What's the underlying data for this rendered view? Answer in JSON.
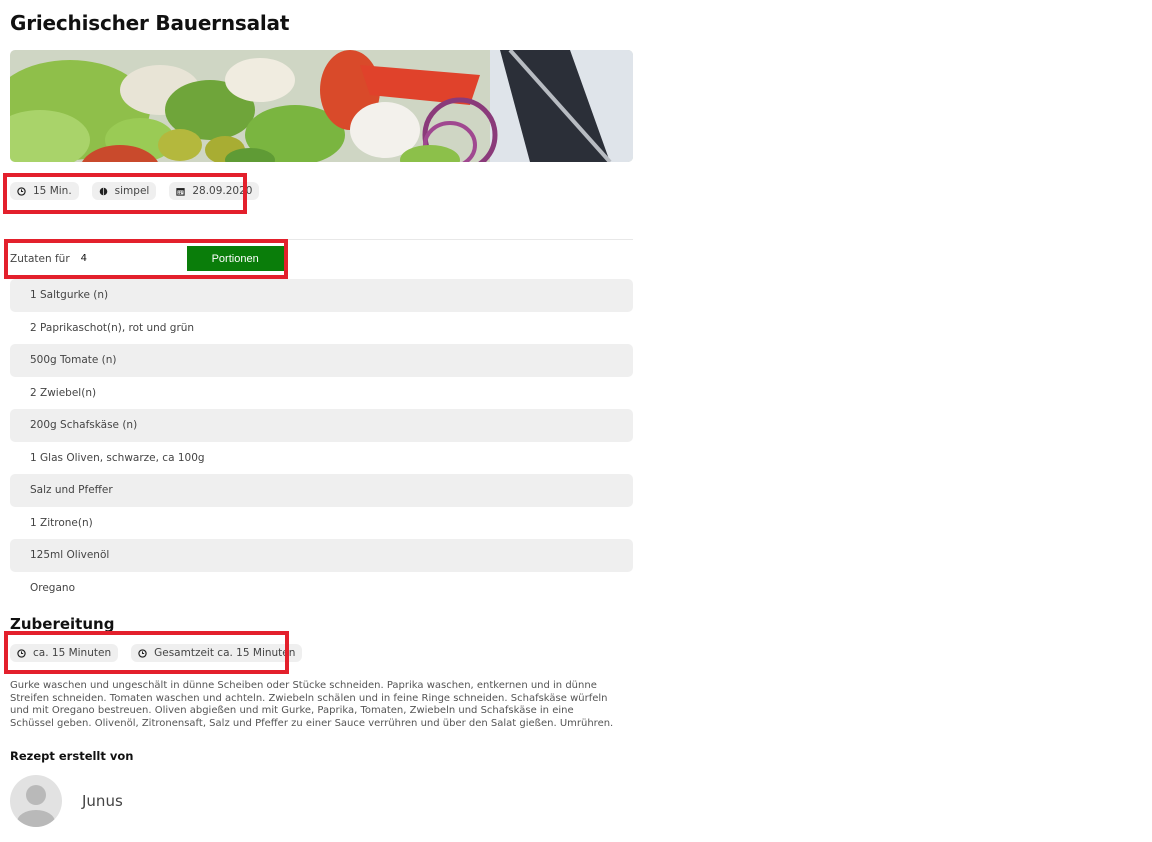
{
  "recipe": {
    "title": "Griechischer Bauernsalat",
    "meta": {
      "duration": "15 Min.",
      "difficulty": "simpel",
      "date": "28.09.2020"
    },
    "servings": {
      "label": "Zutaten für",
      "value": "4",
      "button_label": "Portionen"
    },
    "ingredients": [
      "1 Saltgurke (n)",
      "2 Paprikaschot(n), rot und grün",
      "500g Tomate (n)",
      "2 Zwiebel(n)",
      "200g Schafskäse (n)",
      "1 Glas Oliven, schwarze, ca 100g",
      "Salz und Pfeffer",
      "1 Zitrone(n)",
      "125ml Olivenöl",
      "Oregano"
    ],
    "preparation": {
      "title": "Zubereitung",
      "work_time": "ca. 15 Minuten",
      "total_time": "Gesamtzeit ca. 15 Minuten",
      "text": "Gurke waschen und ungeschält in dünne Scheiben oder Stücke schneiden. Paprika waschen, entkernen und in dünne Streifen schneiden. Tomaten waschen und achteln. Zwiebeln schälen und in feine Ringe schneiden. Schafskäse würfeln und mit Oregano bestreuen. Oliven abgießen und mit Gurke, Paprika, Tomaten, Zwiebeln und Schafskäse in eine Schüssel geben. Olivenöl, Zitronensaft, Salz und Pfeffer zu einer Sauce verrühren und über den Salat gießen. Umrühren."
    },
    "author": {
      "label": "Rezept erstellt von",
      "name": "Junus"
    }
  },
  "colors": {
    "accent_button": "#0a7d0a",
    "highlight_border": "#e3202c",
    "pill_background": "#efefef"
  },
  "icons": {
    "duration": "clock-icon",
    "difficulty": "difficulty-icon",
    "date": "calendar-icon",
    "work_time": "clock-icon",
    "total_time": "clock-icon",
    "avatar": "user-avatar-icon"
  }
}
